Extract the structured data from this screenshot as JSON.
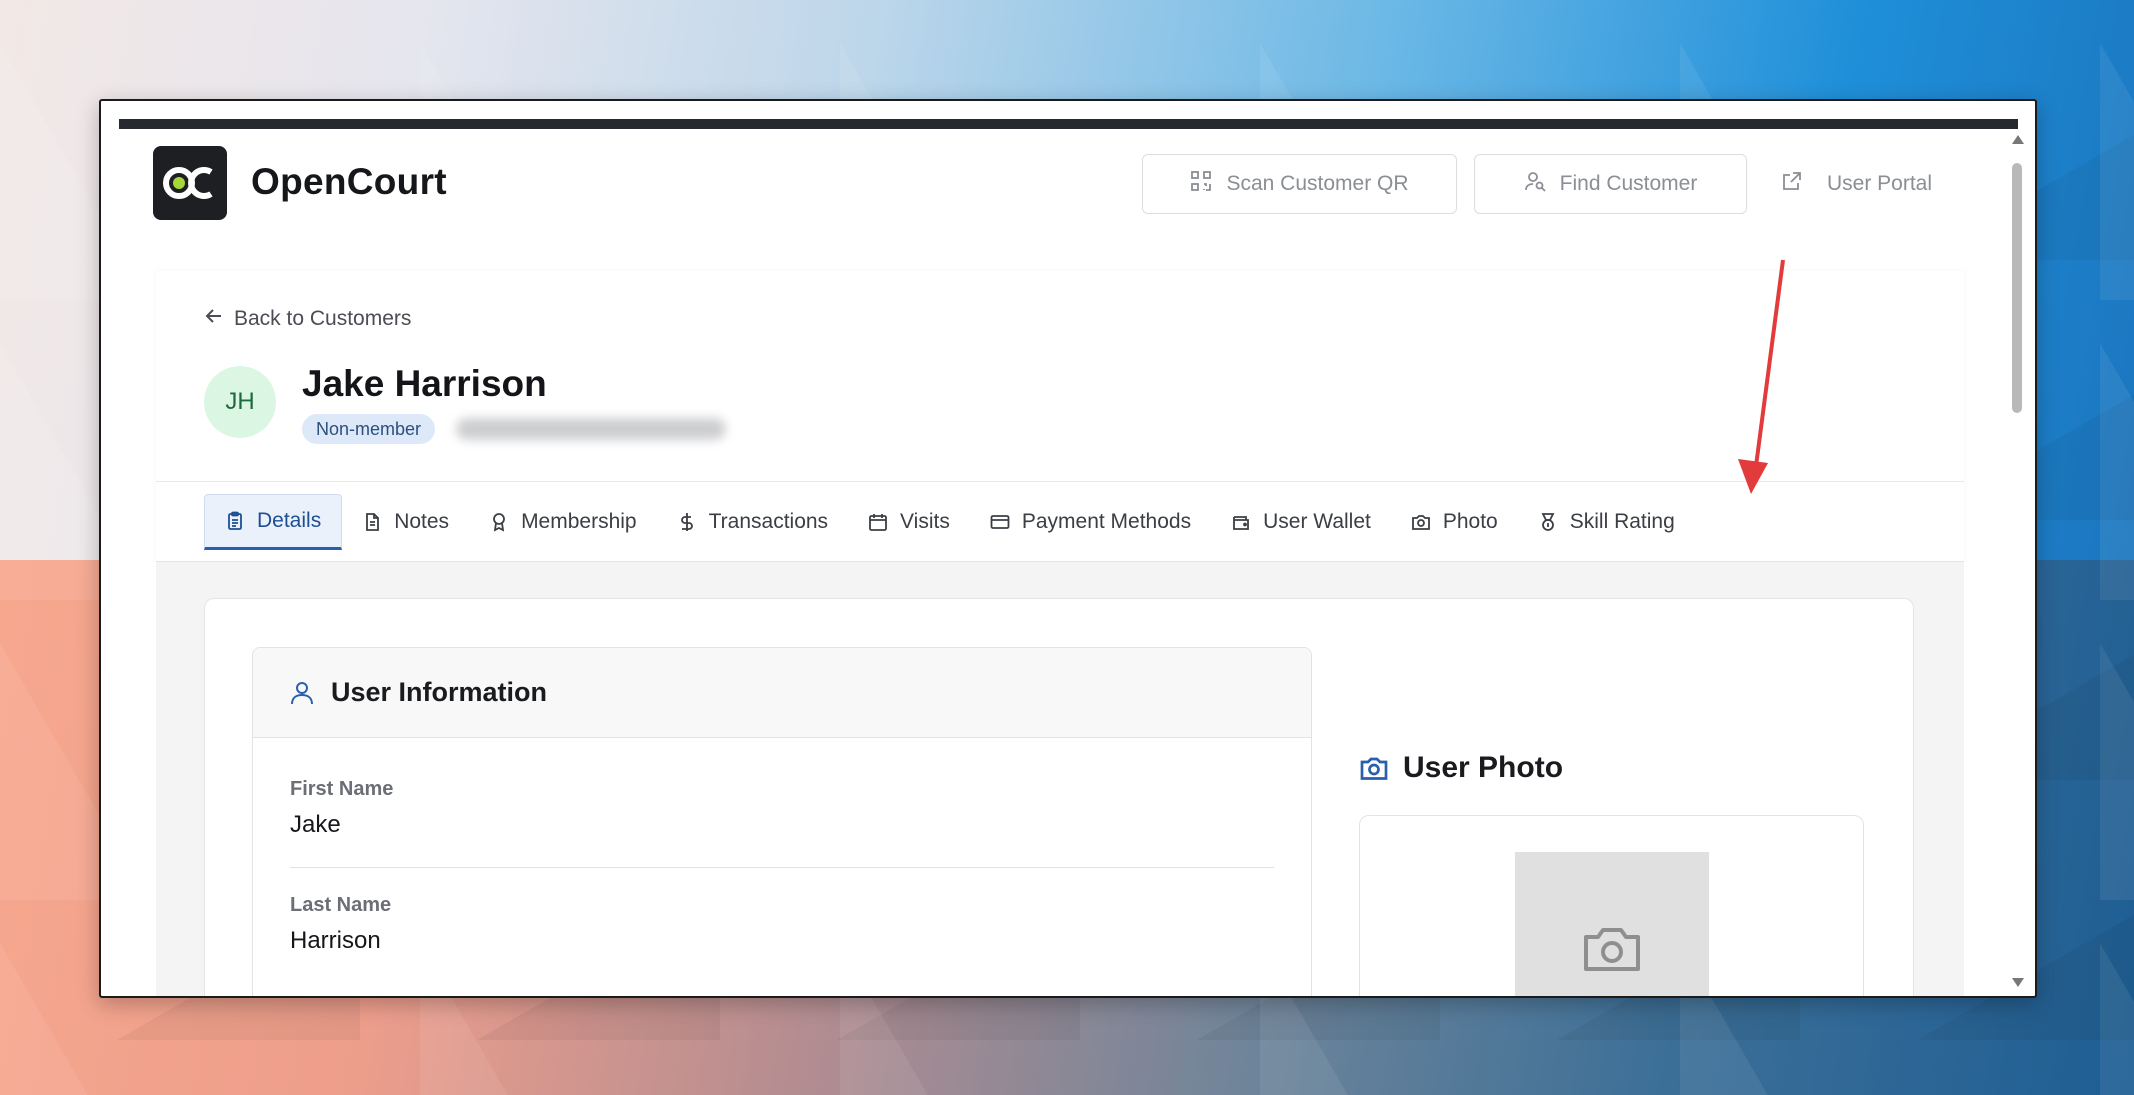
{
  "app": {
    "brand": "OpenCourt"
  },
  "header": {
    "scan_label": "Scan Customer QR",
    "find_label": "Find Customer",
    "portal_label": "User Portal"
  },
  "profile": {
    "back_label": "Back to Customers",
    "initials": "JH",
    "name": "Jake Harrison",
    "badge": "Non-member"
  },
  "tabs": [
    {
      "label": "Details",
      "icon": "clipboard-icon",
      "active": true
    },
    {
      "label": "Notes",
      "icon": "document-icon"
    },
    {
      "label": "Membership",
      "icon": "award-icon"
    },
    {
      "label": "Transactions",
      "icon": "dollar-icon"
    },
    {
      "label": "Visits",
      "icon": "calendar-icon"
    },
    {
      "label": "Payment Methods",
      "icon": "credit-card-icon"
    },
    {
      "label": "User Wallet",
      "icon": "wallet-icon"
    },
    {
      "label": "Photo",
      "icon": "camera-icon"
    },
    {
      "label": "Skill Rating",
      "icon": "medal-icon"
    }
  ],
  "user_info": {
    "title": "User Information",
    "fields": [
      {
        "label": "First Name",
        "value": "Jake"
      },
      {
        "label": "Last Name",
        "value": "Harrison"
      }
    ]
  },
  "user_photo": {
    "title": "User Photo"
  },
  "colors": {
    "accent": "#2a5fae",
    "arrow": "#e23b3b",
    "badge_bg": "#dde9f8",
    "avatar_bg": "#dcf6e4"
  }
}
